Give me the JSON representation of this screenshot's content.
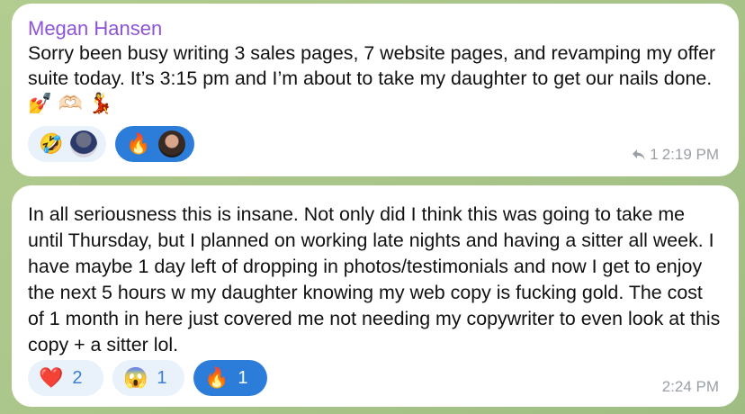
{
  "messages": [
    {
      "sender": "Megan Hansen",
      "text": "Sorry been busy writing 3 sales pages, 7 website pages, and revamping my offer suite today. It’s 3:15 pm and I’m about to take my daughter to get our nails done.",
      "emojis": "💅 🫶🏻 💃",
      "reactions": [
        {
          "emoji": "🤣",
          "type": "avatar",
          "active": false
        },
        {
          "emoji": "🔥",
          "type": "avatar",
          "active": true
        }
      ],
      "reply_count": "1",
      "time": "2:19 PM"
    },
    {
      "text": "In all seriousness this is insane. Not only did I think this was going to take me until Thursday, but I planned on working late nights and having a sitter all week. I have maybe 1 day left of dropping in photos/testimonials and now I get to enjoy the next 5 hours w my daughter knowing my web copy is fucking gold. The cost of 1 month in here just covered me not needing my copywriter to even look at this copy  + a sitter lol.",
      "reactions": [
        {
          "emoji": "❤️",
          "count": "2",
          "active": false
        },
        {
          "emoji": "😱",
          "count": "1",
          "active": false
        },
        {
          "emoji": "🔥",
          "count": "1",
          "active": true
        }
      ],
      "time": "2:24 PM"
    }
  ],
  "colors": {
    "sender": "#8d54d6",
    "reaction_bg": "#e9f1fa",
    "reaction_active": "#2c7dd9",
    "chat_bg": "#a9c48a"
  }
}
